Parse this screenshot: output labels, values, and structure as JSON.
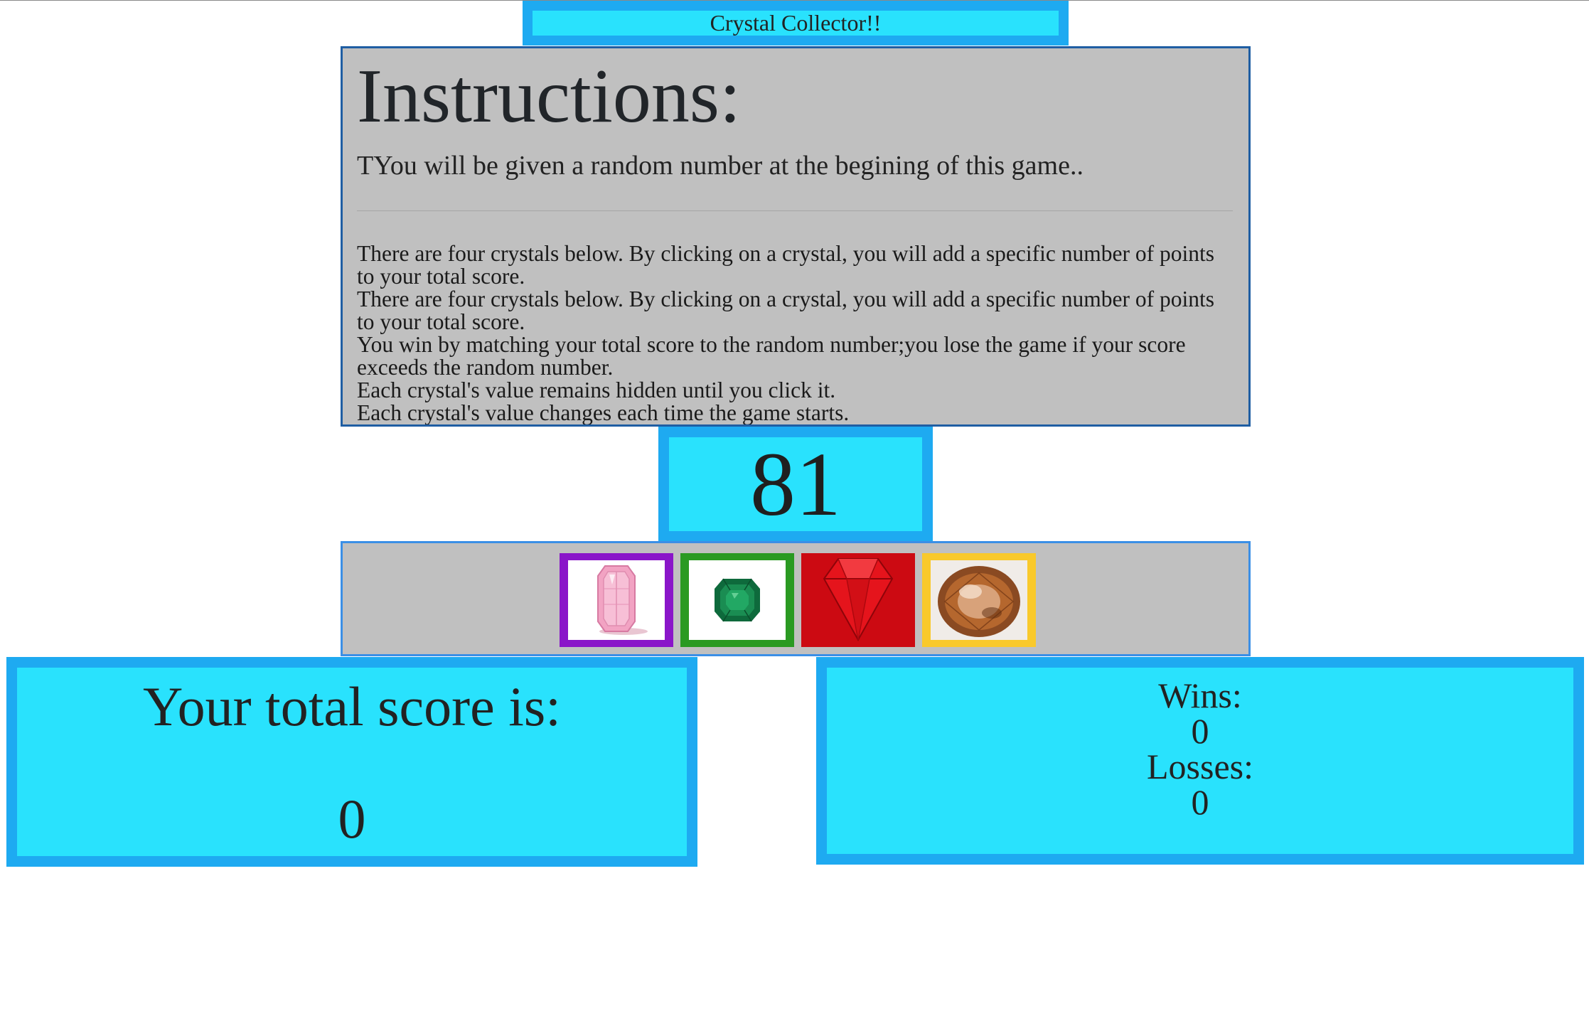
{
  "header": {
    "title": "Crystal Collector!!"
  },
  "instructions": {
    "heading": "Instructions:",
    "lead": "TYou will be given a random number at the begining of this game..",
    "lines": [
      "There are four crystals below. By clicking on a crystal, you will add a specific number of points to your total score.",
      "There are four crystals below. By clicking on a crystal, you will add a specific number of points to your total score.",
      "You win by matching your total score to the random number;you lose the game if your score exceeds the random number.",
      "Each crystal's value remains hidden until you click it.",
      "Each crystal's value changes each time the game starts."
    ]
  },
  "target": {
    "number": "81"
  },
  "crystals": [
    {
      "name": "pink-diamond-icon",
      "border_color": "#8a16c9"
    },
    {
      "name": "emerald-icon",
      "border_color": "#2a9a22"
    },
    {
      "name": "ruby-icon",
      "border_color": "#cc0a12"
    },
    {
      "name": "topaz-icon",
      "border_color": "#f9c92b"
    }
  ],
  "score": {
    "label": "Your total score is:",
    "value": "0"
  },
  "stats": {
    "wins_label": "Wins:",
    "wins": "0",
    "losses_label": "Losses:",
    "losses": "0"
  },
  "colors": {
    "frame": "#1eaaf1",
    "panel": "#29e2fd",
    "instructions_bg": "#c0c0c0"
  }
}
